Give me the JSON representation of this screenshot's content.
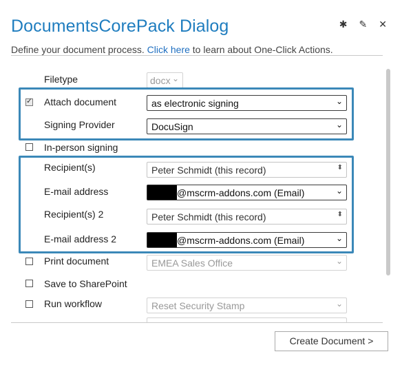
{
  "dialog": {
    "title": "DocumentsCorePack Dialog",
    "subtitle_pre": "Define your document process.",
    "subtitle_link": "Click here",
    "subtitle_post": "to learn about One-Click Actions."
  },
  "header_icons": {
    "settings": "✱",
    "edit": "✎",
    "close": "✕"
  },
  "form": {
    "filetype": {
      "label": "Filetype",
      "value": "docx"
    },
    "attach_document": {
      "label": "Attach document",
      "checked": true,
      "value": "as electronic signing"
    },
    "signing_provider": {
      "label": "Signing Provider",
      "value": "DocuSign"
    },
    "in_person_signing": {
      "label": "In-person signing",
      "checked": false
    },
    "recipient1": {
      "label": "Recipient(s)",
      "value": "Peter Schmidt (this record)"
    },
    "email1": {
      "label": "E-mail address",
      "value": "@mscrm-addons.com (Email)"
    },
    "recipient2": {
      "label": "Recipient(s) 2",
      "value": "Peter Schmidt (this record)"
    },
    "email2": {
      "label": "E-mail address 2",
      "value": "@mscrm-addons.com (Email)"
    },
    "print_document": {
      "label": "Print document",
      "checked": false,
      "value": "EMEA Sales Office"
    },
    "save_sharepoint": {
      "label": "Save to SharePoint",
      "checked": false
    },
    "run_workflow": {
      "label": "Run workflow",
      "checked": false,
      "value": "Reset Security Stamp"
    }
  },
  "footer": {
    "create_button": "Create Document >"
  },
  "colors": {
    "title": "#1f7dbf",
    "highlight_border": "#3b88b8",
    "link": "#1f6fc0"
  }
}
